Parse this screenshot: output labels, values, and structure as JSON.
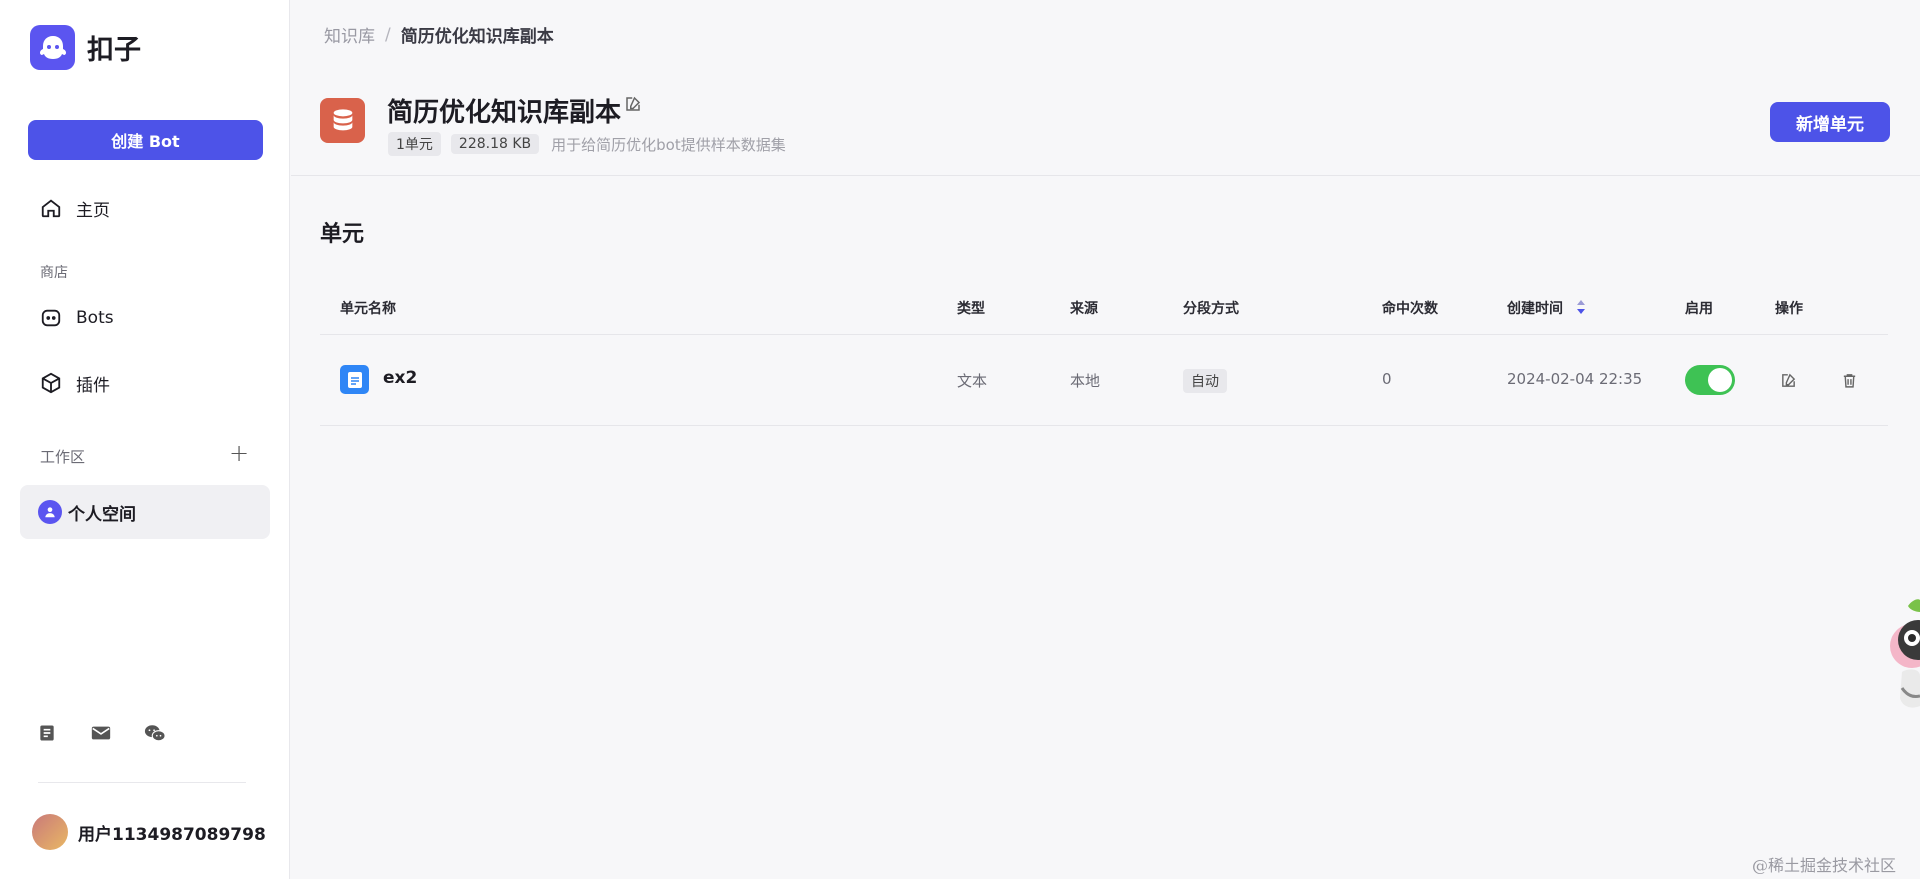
{
  "app": {
    "name": "扣子"
  },
  "sidebar": {
    "create_button": "创建 Bot",
    "home": "主页",
    "store_label": "商店",
    "bots": "Bots",
    "plugins": "插件",
    "workspace_label": "工作区",
    "workspace_item": "个人空间",
    "footer_icons": [
      "document-icon",
      "mail-icon",
      "wechat-icon"
    ],
    "user_name": "用户1134987089798"
  },
  "breadcrumb": {
    "parent": "知识库",
    "separator": "/",
    "current": "简历优化知识库副本"
  },
  "knowledge_base": {
    "title": "简历优化知识库副本",
    "units": "1单元",
    "size": "228.18 KB",
    "description": "用于给简历优化bot提供样本数据集"
  },
  "actions": {
    "add_unit": "新增单元"
  },
  "section_title": "单元",
  "table": {
    "headers": {
      "name": "单元名称",
      "type": "类型",
      "source": "来源",
      "segment": "分段方式",
      "hits": "命中次数",
      "created": "创建时间",
      "enabled": "启用",
      "ops": "操作"
    },
    "rows": [
      {
        "name": "ex2",
        "type": "文本",
        "source": "本地",
        "segment": "自动",
        "hits": "0",
        "created": "2024-02-04 22:35",
        "enabled": true
      }
    ]
  },
  "colors": {
    "accent": "#4d53e8",
    "kb_icon": "#d9624b",
    "toggle_on": "#3ec254",
    "file_icon": "#2f86f6"
  },
  "watermark": "@稀土掘金技术社区"
}
